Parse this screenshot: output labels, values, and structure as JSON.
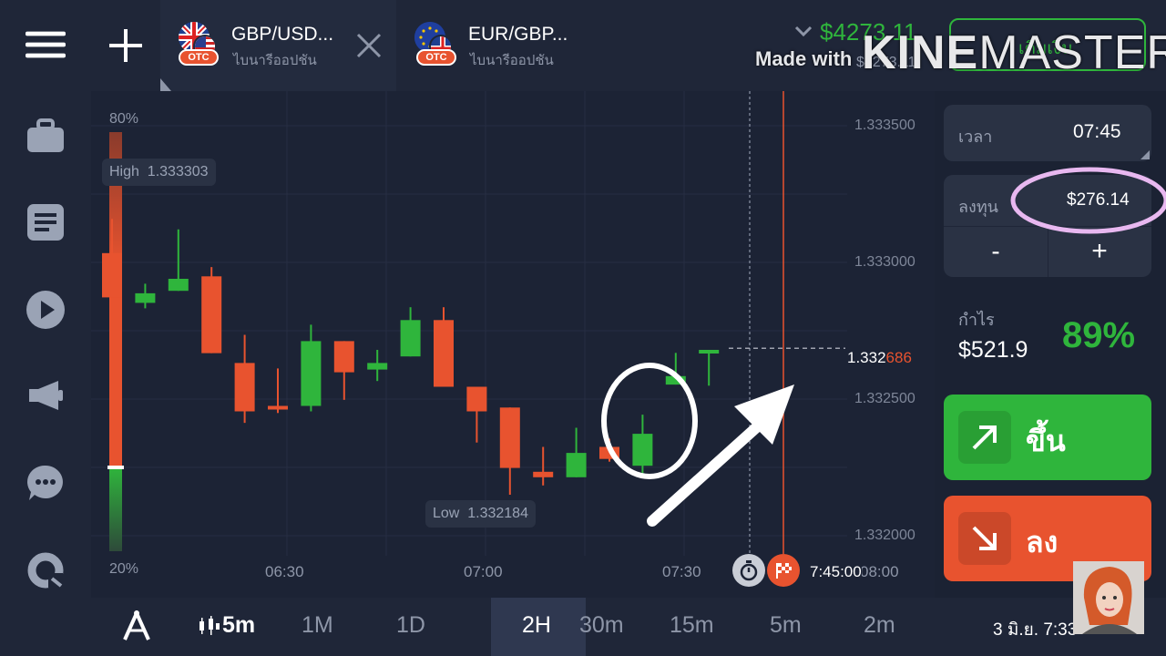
{
  "header": {
    "tabs": [
      {
        "title": "GBP/USD...",
        "subtitle": "ไบนารีออปชัน",
        "badge": "OTC"
      },
      {
        "title": "EUR/GBP...",
        "subtitle": "ไบนารีออปชัน",
        "badge": "OTC"
      }
    ],
    "balance": "$4273.11",
    "balance_sub": "$4273.11",
    "deposit_label": "เติมเงิน",
    "watermark_prefix": "Made with",
    "watermark_brand_a": "KINE",
    "watermark_brand_b": "MASTER"
  },
  "chart_data": {
    "type": "candlestick",
    "price_scale": [
      1.3315,
      1.3338
    ],
    "y_ticks": [
      "1.333500",
      "1.333000",
      "1.332500",
      "1.332000"
    ],
    "x_ticks": [
      "06:30",
      "07:00",
      "07:30",
      "08:00"
    ],
    "high_label": "High  1.333303",
    "low_label": "Low  1.332184",
    "current_price_main": "1.332",
    "current_price_tail": "686",
    "current_price": 1.332686,
    "expiry_time": "7:45:00",
    "sentiment_top": "80%",
    "sentiment_bottom": "20%",
    "sentiment_up": 0.2,
    "candles": [
      {
        "open": 1.333034,
        "close": 1.332872,
        "high": 1.333159,
        "low": 1.332872
      },
      {
        "open": 1.332852,
        "close": 1.332887,
        "high": 1.332922,
        "low": 1.332832
      },
      {
        "open": 1.332896,
        "close": 1.33294,
        "high": 1.333121,
        "low": 1.332896
      },
      {
        "open": 1.332949,
        "close": 1.332668,
        "high": 1.332983,
        "low": 1.332668
      },
      {
        "open": 1.332632,
        "close": 1.332455,
        "high": 1.332735,
        "low": 1.332413
      },
      {
        "open": 1.332475,
        "close": 1.332469,
        "high": 1.332612,
        "low": 1.332449
      },
      {
        "open": 1.332475,
        "close": 1.332712,
        "high": 1.332772,
        "low": 1.332455
      },
      {
        "open": 1.332712,
        "close": 1.332598,
        "high": 1.332712,
        "low": 1.332497
      },
      {
        "open": 1.332608,
        "close": 1.332632,
        "high": 1.33268,
        "low": 1.332566
      },
      {
        "open": 1.332656,
        "close": 1.332789,
        "high": 1.332836,
        "low": 1.332656
      },
      {
        "open": 1.332789,
        "close": 1.332545,
        "high": 1.332836,
        "low": 1.332545
      },
      {
        "open": 1.332545,
        "close": 1.332455,
        "high": 1.332545,
        "low": 1.332341
      },
      {
        "open": 1.332469,
        "close": 1.332248,
        "high": 1.332469,
        "low": 1.33215
      },
      {
        "open": 1.332234,
        "close": 1.332214,
        "high": 1.332325,
        "low": 1.332184
      },
      {
        "open": 1.332214,
        "close": 1.332303,
        "high": 1.332395,
        "low": 1.332214
      },
      {
        "open": 1.332325,
        "close": 1.332281,
        "high": 1.332355,
        "low": 1.332271
      },
      {
        "open": 1.332256,
        "close": 1.332373,
        "high": 1.332443,
        "low": 1.332224
      },
      {
        "open": 1.332553,
        "close": 1.332584,
        "high": 1.332669,
        "low": 1.332553
      },
      {
        "open": 1.332669,
        "close": 1.33268,
        "high": 1.33268,
        "low": 1.332549
      }
    ]
  },
  "panel": {
    "time_label": "เวลา",
    "time_value": "07:45",
    "invest_label": "ลงทุน",
    "invest_value": "$276.14",
    "minus_label": "-",
    "plus_label": "+",
    "profit_label": "กำไร",
    "profit_value": "$521.9",
    "profit_percent": "89%",
    "up_label": "ขึ้น",
    "down_label": "ลง"
  },
  "timeframes": {
    "candle_interval": "5m",
    "options": [
      "1M",
      "1D",
      "2H",
      "30m",
      "15m",
      "5m",
      "2m"
    ],
    "selected": "2H"
  },
  "footer": {
    "datetime": "3 มิ.ย. 7:33"
  },
  "colors": {
    "up": "#2fb53c",
    "down": "#e8532f",
    "background": "#1c2335",
    "annotation": "#ffffff",
    "highlight": "#e8b8f0"
  },
  "icons": {
    "sidebar": [
      "menu-icon",
      "briefcase-icon",
      "document-icon",
      "play-icon",
      "megaphone-icon",
      "chat-icon",
      "support-icon"
    ]
  }
}
